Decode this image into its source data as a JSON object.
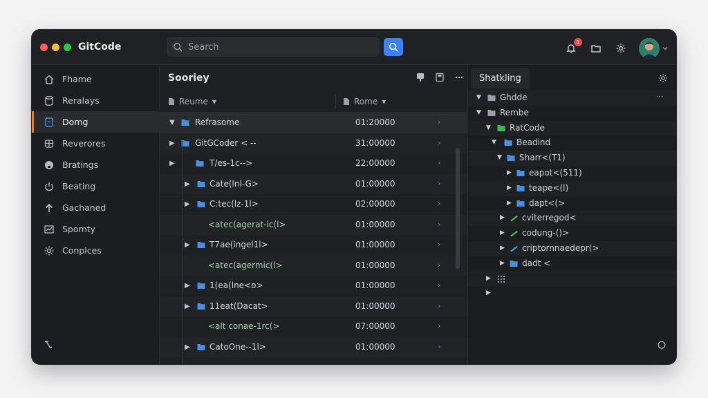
{
  "app": {
    "title": "GitCode"
  },
  "colors": {
    "accent": "#3b82f6",
    "active_marker": "#f07a2b",
    "close": "#ff5f57",
    "minimize": "#febc2e",
    "zoom": "#28c840"
  },
  "search": {
    "placeholder": "Search"
  },
  "notifications": {
    "count": "1"
  },
  "sidebar": {
    "items": [
      {
        "label": "Fhame",
        "icon": "home-icon"
      },
      {
        "label": "Reralays",
        "icon": "cylinder-icon"
      },
      {
        "label": "Domg",
        "icon": "file-icon",
        "active": true
      },
      {
        "label": "Reverores",
        "icon": "archive-icon"
      },
      {
        "label": "Bratings",
        "icon": "github-icon"
      },
      {
        "label": "Beating",
        "icon": "power-icon"
      },
      {
        "label": "Gachaned",
        "icon": "upload-icon"
      },
      {
        "label": "Spomty",
        "icon": "chart-icon"
      },
      {
        "label": "Conplces",
        "icon": "gear-icon"
      }
    ]
  },
  "main": {
    "title": "Sooriey",
    "columns": {
      "name": "Reume",
      "time": "Rome"
    },
    "rows": [
      {
        "indent": 0,
        "caret": "down",
        "folder": true,
        "name": "Refrasome",
        "time": "01:20000",
        "code": false
      },
      {
        "indent": 0,
        "caret": "right",
        "folder": true,
        "name": "GitGCoder < --",
        "time": "31:00000",
        "code": false
      },
      {
        "indent": 1,
        "caret": "right",
        "folder": true,
        "name": "T/es-1c-->",
        "time": "22:00000",
        "code": false
      },
      {
        "indent": 2,
        "caret": "right",
        "folder": true,
        "name": "Cate(lnl-G>",
        "time": "01:00000",
        "code": false
      },
      {
        "indent": 2,
        "caret": "right",
        "folder": true,
        "name": "C:tec(lz-1l>",
        "time": "02:00000",
        "code": false
      },
      {
        "indent": 3,
        "caret": "",
        "folder": false,
        "name": "<atec(agerat-ic(l>",
        "time": "01:00000",
        "code": true
      },
      {
        "indent": 2,
        "caret": "right",
        "folder": true,
        "name": "T7ae(ingel1l>",
        "time": "01:00000",
        "code": false
      },
      {
        "indent": 3,
        "caret": "",
        "folder": false,
        "name": "<atec(agermic(l>",
        "time": "01:00000",
        "code": true
      },
      {
        "indent": 2,
        "caret": "right",
        "folder": true,
        "name": "1(ea(lne<o>",
        "time": "01:00000",
        "code": false
      },
      {
        "indent": 2,
        "caret": "right",
        "folder": true,
        "name": "11eat(Dacat>",
        "time": "01:00000",
        "code": false
      },
      {
        "indent": 3,
        "caret": "",
        "folder": false,
        "name": "<alt conae-1rc(>",
        "time": "07:00000",
        "code": true
      },
      {
        "indent": 2,
        "caret": "right",
        "folder": true,
        "name": "CatoOne--1l>",
        "time": "01:00000",
        "code": false
      }
    ]
  },
  "panel": {
    "tab": "Shatkling",
    "tree": [
      {
        "indent": 0,
        "caret": "down",
        "icon": "gray-folder",
        "label": "Ghdde",
        "more": "···"
      },
      {
        "indent": 0,
        "caret": "down",
        "icon": "gray-folder",
        "label": "Rembe"
      },
      {
        "indent": 1,
        "caret": "down",
        "icon": "green-folder",
        "label": "RatCode"
      },
      {
        "indent": 2,
        "caret": "down",
        "icon": "blue-folder",
        "label": "Beadind"
      },
      {
        "indent": 3,
        "caret": "down",
        "icon": "blue-folder",
        "label": "Sharr<(T1)"
      },
      {
        "indent": 4,
        "caret": "right",
        "icon": "blue-folder",
        "label": "eapot<(511)"
      },
      {
        "indent": 4,
        "caret": "right",
        "icon": "blue-folder",
        "label": "teape<(l)"
      },
      {
        "indent": 4,
        "caret": "right",
        "icon": "blue-folder",
        "label": "dapt<(>"
      },
      {
        "indent": 3,
        "caret": "right",
        "icon": "green-pencil",
        "label": "cviterregod<"
      },
      {
        "indent": 3,
        "caret": "right",
        "icon": "green-pencil",
        "label": "codung-()>"
      },
      {
        "indent": 3,
        "caret": "right",
        "icon": "blue-pencil",
        "label": "criptornnaedepr(>"
      },
      {
        "indent": 3,
        "caret": "right",
        "icon": "blue-folder",
        "label": "dadt <"
      },
      {
        "indent": 1,
        "caret": "right",
        "icon": "grid-dots",
        "label": ""
      },
      {
        "indent": 1,
        "caret": "right",
        "icon": "",
        "label": ""
      }
    ]
  }
}
